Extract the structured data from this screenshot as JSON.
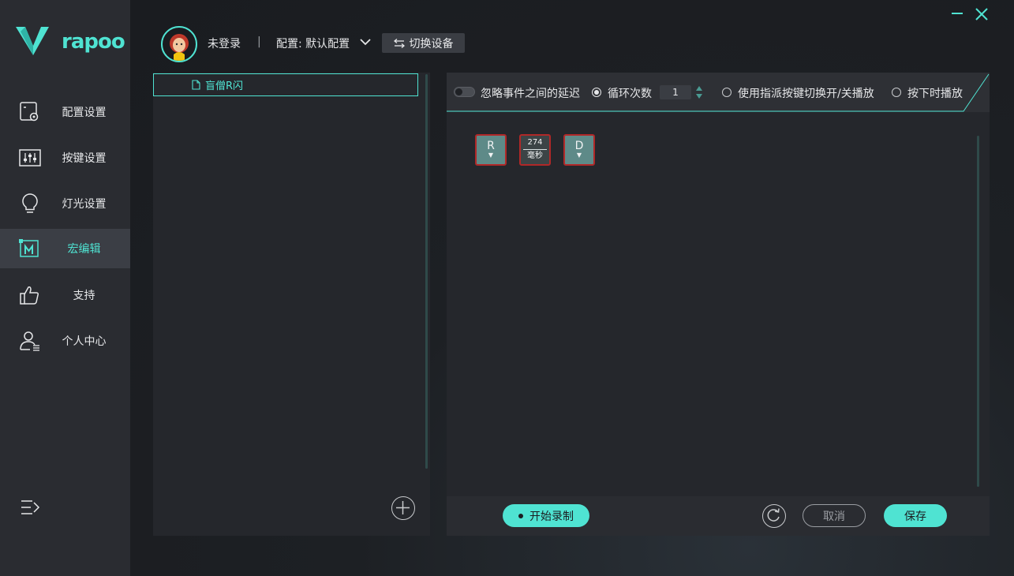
{
  "brand": {
    "logo_text": "rapoo"
  },
  "colors": {
    "accent": "#4fe3d2",
    "key_fill": "#5e8a88",
    "key_border": "#b02828",
    "sidebar_bg": "#2a2c31"
  },
  "sidebar": {
    "items": [
      {
        "label": "配置设置",
        "icon": "config-icon"
      },
      {
        "label": "按键设置",
        "icon": "sliders-icon"
      },
      {
        "label": "灯光设置",
        "icon": "bulb-icon"
      },
      {
        "label": "宏编辑",
        "icon": "macro-icon",
        "active": true
      },
      {
        "label": "支持",
        "icon": "thumbs-up-icon"
      },
      {
        "label": "个人中心",
        "icon": "user-icon"
      }
    ]
  },
  "header": {
    "login_status": "未登录",
    "separator": "|",
    "profile_label": "配置: 默认配置",
    "switch_device_label": "切换设备"
  },
  "macro_list": {
    "items": [
      {
        "name": "盲僧R闪"
      }
    ]
  },
  "toolbar": {
    "ignore_delay_label": "忽略事件之间的延迟",
    "loop_count_label": "循环次数",
    "loop_count_value": "1",
    "toggle_label": "使用指派按键切换开/关播放",
    "press_play_label": "按下时播放"
  },
  "sequence": [
    {
      "type": "key",
      "label": "R"
    },
    {
      "type": "delay",
      "value": "274",
      "unit": "毫秒"
    },
    {
      "type": "key",
      "label": "D"
    }
  ],
  "footer": {
    "record_label": "开始录制",
    "cancel_label": "取消",
    "save_label": "保存"
  }
}
